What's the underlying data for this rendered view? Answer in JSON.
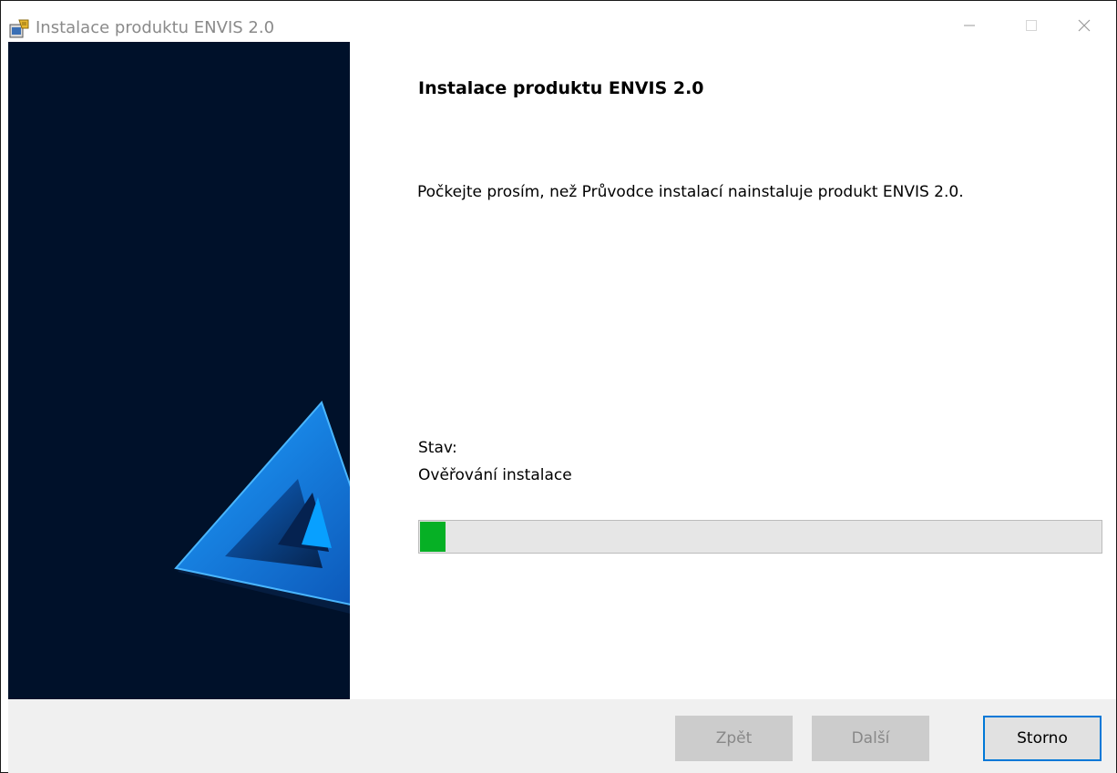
{
  "window": {
    "title": "Instalace produktu ENVIS 2.0",
    "icons": {
      "app": "installer-icon",
      "minimize": "minimize-icon",
      "maximize": "maximize-icon",
      "close": "close-icon"
    }
  },
  "sidebar": {
    "logo": "triangle-logo"
  },
  "content": {
    "heading": "Instalace produktu ENVIS 2.0",
    "description": "Počkejte prosím, než Průvodce instalací nainstaluje produkt ENVIS 2.0.",
    "status_label": "Stav:",
    "status_value": "Ověřování instalace",
    "progress_fraction": 0.037
  },
  "buttons": {
    "back": "Zpět",
    "next": "Další",
    "cancel": "Storno"
  },
  "colors": {
    "sidebar_bg": "#00112a",
    "progress_fill": "#06b025",
    "focus_border": "#0078d7",
    "logo_blue": "#1e90e8"
  }
}
